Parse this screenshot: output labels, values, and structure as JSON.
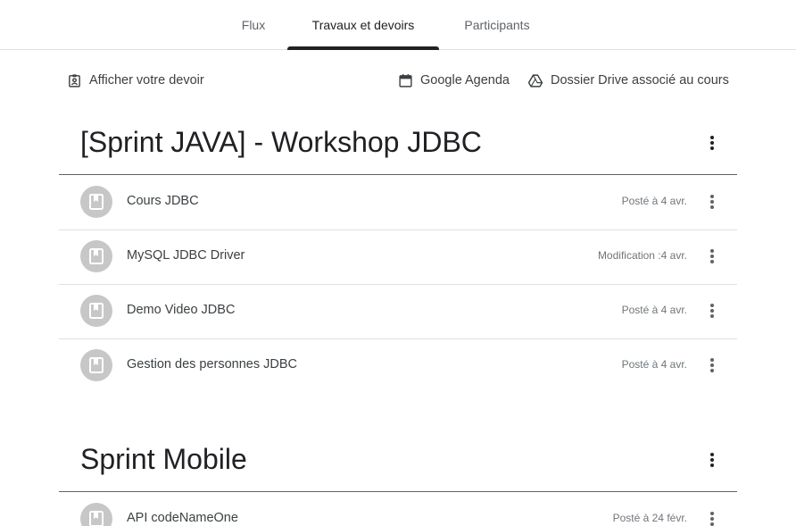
{
  "tabs": [
    {
      "label": "Flux"
    },
    {
      "label": "Travaux et devoirs"
    },
    {
      "label": "Participants"
    }
  ],
  "toolbar": {
    "view_work": "Afficher votre devoir",
    "calendar": "Google Agenda",
    "drive": "Dossier Drive associé au cours"
  },
  "topics": [
    {
      "title": "[Sprint JAVA] - Workshop JDBC",
      "items": [
        {
          "title": "Cours JDBC",
          "date": "Posté à 4 avr."
        },
        {
          "title": "MySQL JDBC Driver",
          "date": "Modification :4 avr."
        },
        {
          "title": "Demo Video JDBC",
          "date": "Posté à 4 avr."
        },
        {
          "title": "Gestion des personnes JDBC",
          "date": "Posté à 4 avr."
        }
      ]
    },
    {
      "title": "Sprint Mobile",
      "items": [
        {
          "title": "API codeNameOne",
          "date": "Posté à 24 févr."
        }
      ]
    }
  ],
  "colors": {
    "text": "#3c4043",
    "heading": "#202124",
    "muted": "#70757a",
    "avatar_bg": "#c7c7c7",
    "divider": "#e0e0e0"
  }
}
